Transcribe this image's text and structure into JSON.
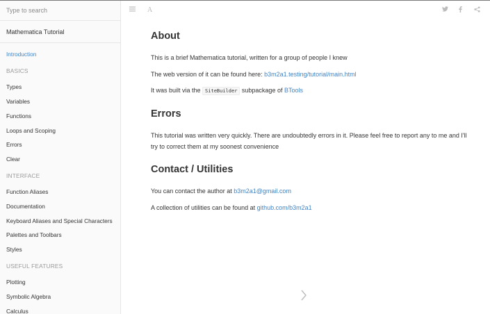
{
  "search": {
    "placeholder": "Type to search"
  },
  "sidebar": {
    "title": "Mathematica Tutorial",
    "items": [
      {
        "label": "Introduction",
        "type": "item",
        "active": true
      },
      {
        "label": "BASICS",
        "type": "header"
      },
      {
        "label": "Types",
        "type": "item"
      },
      {
        "label": "Variables",
        "type": "item"
      },
      {
        "label": "Functions",
        "type": "item"
      },
      {
        "label": "Loops and Scoping",
        "type": "item"
      },
      {
        "label": "Errors",
        "type": "item"
      },
      {
        "label": "Clear",
        "type": "item"
      },
      {
        "label": "INTERFACE",
        "type": "header"
      },
      {
        "label": "Function Aliases",
        "type": "item"
      },
      {
        "label": "Documentation",
        "type": "item"
      },
      {
        "label": "Keyboard Aliases and Special Characters",
        "type": "item"
      },
      {
        "label": "Palettes and Toolbars",
        "type": "item"
      },
      {
        "label": "Styles",
        "type": "item"
      },
      {
        "label": "USEFUL FEATURES",
        "type": "header"
      },
      {
        "label": "Plotting",
        "type": "item"
      },
      {
        "label": "Symbolic Algebra",
        "type": "item"
      },
      {
        "label": "Calculus",
        "type": "item"
      }
    ]
  },
  "toolbar": {
    "menu_icon": "menu-icon",
    "font_icon": "font-settings-icon",
    "font_label": "A",
    "share_icons": [
      "twitter-icon",
      "facebook-icon",
      "share-icon"
    ]
  },
  "content": {
    "about": {
      "heading": "About",
      "p1": "This is a brief Mathematica tutorial, written for a group of people I knew",
      "p2_text": "The web version of it can be found here: ",
      "p2_link": "b3m2a1.testing/tutorial/main.html",
      "p3_text": "It was built via the ",
      "p3_code": "SiteBuilder",
      "p3_mid": " subpackage of ",
      "p3_link": "BTools"
    },
    "errors": {
      "heading": "Errors",
      "p1": "This tutorial was written very quickly. There are undoubtedly errors in it. Please feel free to report any to me and I'll try to correct them at my soonest convenience"
    },
    "contact": {
      "heading": "Contact / Utilities",
      "p1_text": "You can contact the author at ",
      "p1_link": "b3m2a1@gmail.com",
      "p2_text": "A collection of utilities can be found at ",
      "p2_link": "github.com/b3m2a1"
    }
  },
  "next_icon": "chevron-right-icon",
  "colors": {
    "link": "#4183c4",
    "text": "#333333",
    "muted": "#9a9a9a",
    "icon": "#bbbbbb",
    "sidebar_bg": "#fafafa",
    "border": "#e6e6e6"
  }
}
